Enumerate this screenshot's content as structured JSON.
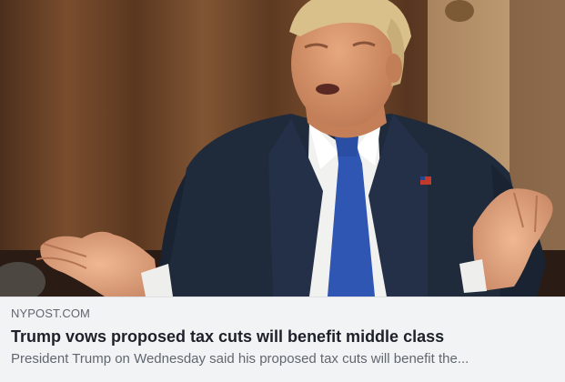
{
  "link_preview": {
    "domain": "NYPOST.COM",
    "headline": "Trump vows proposed tax cuts will benefit middle class",
    "description": "President Trump on Wednesday said his proposed tax cuts will benefit the..."
  },
  "colors": {
    "background": "#f2f3f5",
    "domain_text": "#606770",
    "headline_text": "#1d2129",
    "description_text": "#606770",
    "curtain": "#6b4428",
    "suit": "#1f2a3a",
    "tie": "#2f56b3"
  }
}
